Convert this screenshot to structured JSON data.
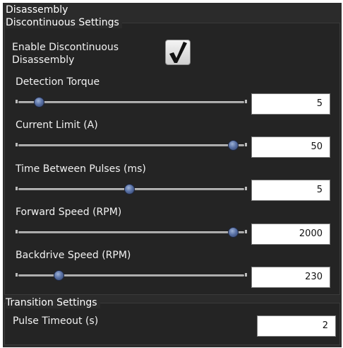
{
  "title": "Disassembly",
  "discontinuous": {
    "title": "Discontinuous Settings",
    "enable_label_line1": "Enable Discontinuous",
    "enable_label_line2": "Disassembly",
    "enable_checked": true,
    "fields": [
      {
        "label": "Detection Torque",
        "value": "5",
        "slider_fraction": 0.08
      },
      {
        "label": "Current Limit (A)",
        "value": "50",
        "slider_fraction": 0.96
      },
      {
        "label": "Time Between Pulses (ms)",
        "value": "5",
        "slider_fraction": 0.49
      },
      {
        "label": "Forward Speed (RPM)",
        "value": "2000",
        "slider_fraction": 0.96
      },
      {
        "label": "Backdrive Speed (RPM)",
        "value": "230",
        "slider_fraction": 0.17
      }
    ]
  },
  "transition": {
    "title": "Transition Settings",
    "pulse_timeout_label": "Pulse Timeout (s)",
    "pulse_timeout_value": "2"
  },
  "colors": {
    "panel_bg": "#2b2b2b",
    "slider_thumb": "#5a72a6"
  }
}
